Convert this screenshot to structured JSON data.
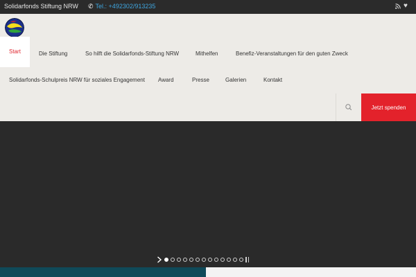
{
  "topbar": {
    "brand": "Solidarfonds Stiftung NRW",
    "phone": "Tel.: +492302/913235",
    "icons": [
      "rss-icon",
      "heart-icon"
    ]
  },
  "nav": {
    "row1": [
      {
        "label": "Start",
        "active": true
      },
      {
        "label": "Die Stiftung",
        "active": false
      },
      {
        "label": "So hilft die Solidarfonds-Stiftung NRW",
        "active": false
      },
      {
        "label": "Mithelfen",
        "active": false
      },
      {
        "label": "Benefiz-Veranstaltungen für den guten Zweck",
        "active": false
      }
    ],
    "row2": [
      {
        "label": "Solidarfonds-Schulpreis NRW für soziales Engagement"
      },
      {
        "label": "Award"
      },
      {
        "label": "Presse"
      },
      {
        "label": "Galerien"
      },
      {
        "label": "Kontakt"
      }
    ]
  },
  "actions": {
    "search_icon": "search-icon",
    "donate_label": "Jetzt spenden"
  },
  "slider": {
    "dot_count": 13,
    "active_index": 0,
    "controls": [
      "play-icon",
      "pause-icon"
    ]
  },
  "colors": {
    "accent_red": "#e3222b",
    "link_blue": "#3fa6e0",
    "header_bg": "#edebe7",
    "dark_bg": "#2a2a2a",
    "footer_teal": "#0f4a59"
  }
}
